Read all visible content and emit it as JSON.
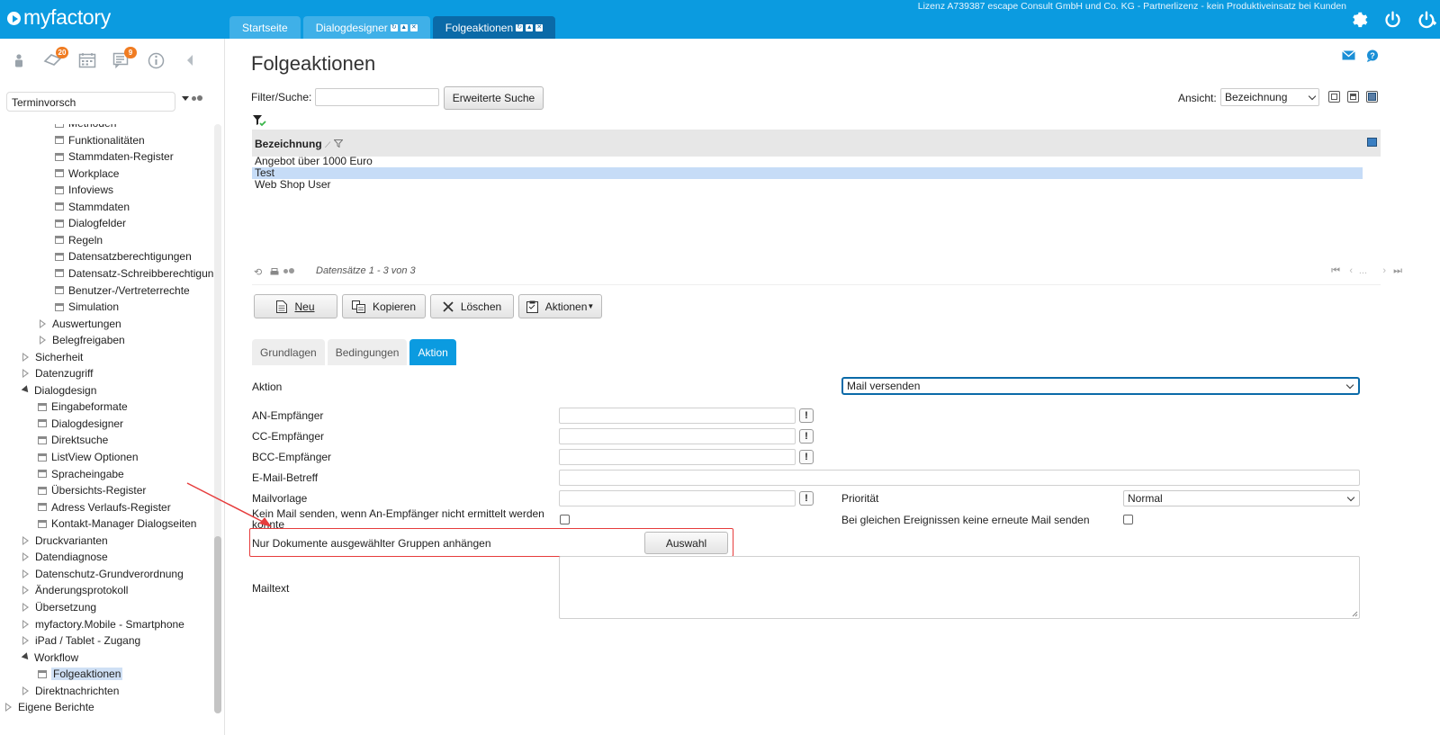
{
  "app": {
    "logo_text": "myfactory",
    "license": "Lizenz A739387 escape Consult GmbH und Co. KG - Partnerlizenz - kein Produktiveinsatz bei Kunden",
    "tabs": [
      {
        "label": "Startseite",
        "active": false
      },
      {
        "label": "Dialogdesigner",
        "active": false
      },
      {
        "label": "Folgeaktionen",
        "active": true
      }
    ]
  },
  "sidebar": {
    "badges": {
      "tasks": "20",
      "notes": "9"
    },
    "treeview_select": "Terminvorsch",
    "tree": [
      {
        "label": "Methoden",
        "indent": 3,
        "type": "leaf"
      },
      {
        "label": "Funktionalitäten",
        "indent": 3,
        "type": "leaf"
      },
      {
        "label": "Stammdaten-Register",
        "indent": 3,
        "type": "leaf"
      },
      {
        "label": "Workplace",
        "indent": 3,
        "type": "leaf"
      },
      {
        "label": "Infoviews",
        "indent": 3,
        "type": "leaf"
      },
      {
        "label": "Stammdaten",
        "indent": 3,
        "type": "leaf"
      },
      {
        "label": "Dialogfelder",
        "indent": 3,
        "type": "leaf"
      },
      {
        "label": "Regeln",
        "indent": 3,
        "type": "leaf"
      },
      {
        "label": "Datensatzberechtigungen",
        "indent": 3,
        "type": "leaf"
      },
      {
        "label": "Datensatz-Schreibberechtigungen",
        "indent": 3,
        "type": "leaf"
      },
      {
        "label": "Benutzer-/Vertreterrechte",
        "indent": 3,
        "type": "leaf"
      },
      {
        "label": "Simulation",
        "indent": 3,
        "type": "leaf"
      },
      {
        "label": "Auswertungen",
        "indent": 2,
        "type": "closed"
      },
      {
        "label": "Belegfreigaben",
        "indent": 2,
        "type": "closed"
      },
      {
        "label": "Sicherheit",
        "indent": 1,
        "type": "closed"
      },
      {
        "label": "Datenzugriff",
        "indent": 1,
        "type": "closed"
      },
      {
        "label": "Dialogdesign",
        "indent": 1,
        "type": "open"
      },
      {
        "label": "Eingabeformate",
        "indent": 2,
        "type": "leaf"
      },
      {
        "label": "Dialogdesigner",
        "indent": 2,
        "type": "leaf"
      },
      {
        "label": "Direktsuche",
        "indent": 2,
        "type": "leaf"
      },
      {
        "label": "ListView Optionen",
        "indent": 2,
        "type": "leaf"
      },
      {
        "label": "Spracheingabe",
        "indent": 2,
        "type": "leaf"
      },
      {
        "label": "Übersichts-Register",
        "indent": 2,
        "type": "leaf"
      },
      {
        "label": "Adress Verlaufs-Register",
        "indent": 2,
        "type": "leaf"
      },
      {
        "label": "Kontakt-Manager Dialogseiten",
        "indent": 2,
        "type": "leaf"
      },
      {
        "label": "Druckvarianten",
        "indent": 1,
        "type": "closed"
      },
      {
        "label": "Datendiagnose",
        "indent": 1,
        "type": "closed"
      },
      {
        "label": "Datenschutz-Grundverordnung",
        "indent": 1,
        "type": "closed"
      },
      {
        "label": "Änderungsprotokoll",
        "indent": 1,
        "type": "closed"
      },
      {
        "label": "Übersetzung",
        "indent": 1,
        "type": "closed"
      },
      {
        "label": "myfactory.Mobile - Smartphone",
        "indent": 1,
        "type": "closed"
      },
      {
        "label": "iPad / Tablet - Zugang",
        "indent": 1,
        "type": "closed"
      },
      {
        "label": "Workflow",
        "indent": 1,
        "type": "open"
      },
      {
        "label": "Folgeaktionen",
        "indent": 2,
        "type": "leaf",
        "selected": true
      },
      {
        "label": "Direktnachrichten",
        "indent": 1,
        "type": "closed"
      },
      {
        "label": "Eigene Berichte",
        "indent": 0,
        "type": "closed"
      }
    ]
  },
  "main": {
    "title": "Folgeaktionen",
    "filter_label": "Filter/Suche:",
    "filter_value": "",
    "advanced_search": "Erweiterte Suche",
    "view_label": "Ansicht:",
    "view_value": "Bezeichnung",
    "grid": {
      "column": "Bezeichnung",
      "rows": [
        {
          "label": "Angebot über 1000 Euro",
          "selected": false
        },
        {
          "label": "Test",
          "selected": true
        },
        {
          "label": "Web Shop User",
          "selected": false
        }
      ],
      "records": "Datensätze 1 - 3 von 3",
      "pager_dots": "..."
    },
    "toolbar": {
      "new": "Neu",
      "copy": "Kopieren",
      "delete": "Löschen",
      "actions": "Aktionen"
    },
    "form_tabs": [
      {
        "label": "Grundlagen",
        "active": false
      },
      {
        "label": "Bedingungen",
        "active": false
      },
      {
        "label": "Aktion",
        "active": true
      }
    ],
    "form": {
      "aktion_label": "Aktion",
      "aktion_value": "Mail versenden",
      "an_label": "AN-Empfänger",
      "cc_label": "CC-Empfänger",
      "bcc_label": "BCC-Empfänger",
      "betreff_label": "E-Mail-Betreff",
      "vorlage_label": "Mailvorlage",
      "prio_label": "Priorität",
      "prio_value": "Normal",
      "no_mail_label_1": "Kein Mail senden, wenn An-Empfänger nicht ermittelt werden",
      "no_mail_label_2": "konnte",
      "same_events_label": "Bei gleichen Ereignissen keine erneute Mail senden",
      "docs_label": "Nur Dokumente ausgewählter Gruppen anhängen",
      "auswahl_button": "Auswahl",
      "mailtext_label": "Mailtext",
      "excl": "!"
    },
    "colors": {
      "brand": "#0b9be0",
      "highlight": "#e63c3c"
    }
  }
}
